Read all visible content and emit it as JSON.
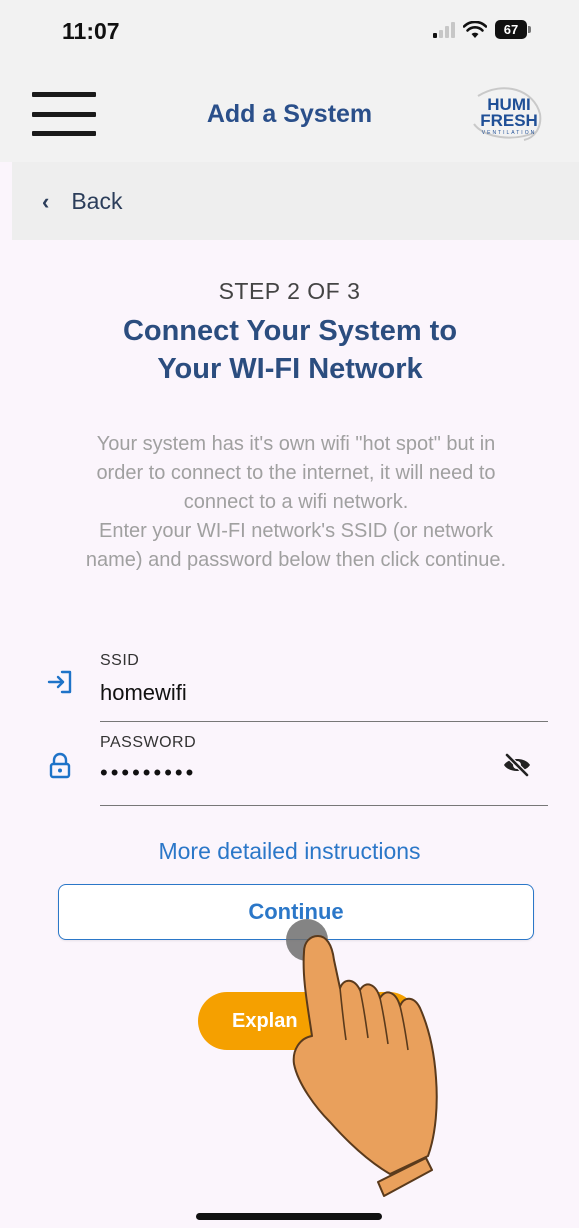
{
  "status_bar": {
    "time": "11:07",
    "battery": "67"
  },
  "app_bar": {
    "title": "Add a System",
    "logo_line1": "HUMI",
    "logo_line2": "FRESH",
    "logo_tagline": "VENTILATION"
  },
  "nav": {
    "back_label": "Back"
  },
  "content": {
    "step_label": "STEP 2 OF 3",
    "heading_line1": "Connect Your System to",
    "heading_line2": "Your WI-FI Network",
    "description_lines": [
      "Your system has it's own wifi \"hot spot\" but in",
      "order to connect to the internet, it will need to",
      "connect to a wifi network.",
      "Enter your WI-FI network's SSID (or network",
      "name) and password below then click continue."
    ]
  },
  "form": {
    "ssid_label": "SSID",
    "ssid_value": "homewifi",
    "password_label": "PASSWORD",
    "password_value": "•••••••••"
  },
  "actions": {
    "instructions_link": "More detailed instructions",
    "continue_label": "Continue",
    "explain_label": "Explan"
  },
  "colors": {
    "accent_blue": "#2b77c8",
    "heading_blue": "#2b4d7f",
    "explain_orange": "#f5a000",
    "background": "#fbf5fc"
  },
  "icons": {
    "menu": "hamburger-menu-icon",
    "back": "chevron-left-icon",
    "ssid": "login-arrow-icon",
    "password": "lock-icon",
    "visibility": "eye-off-icon"
  }
}
